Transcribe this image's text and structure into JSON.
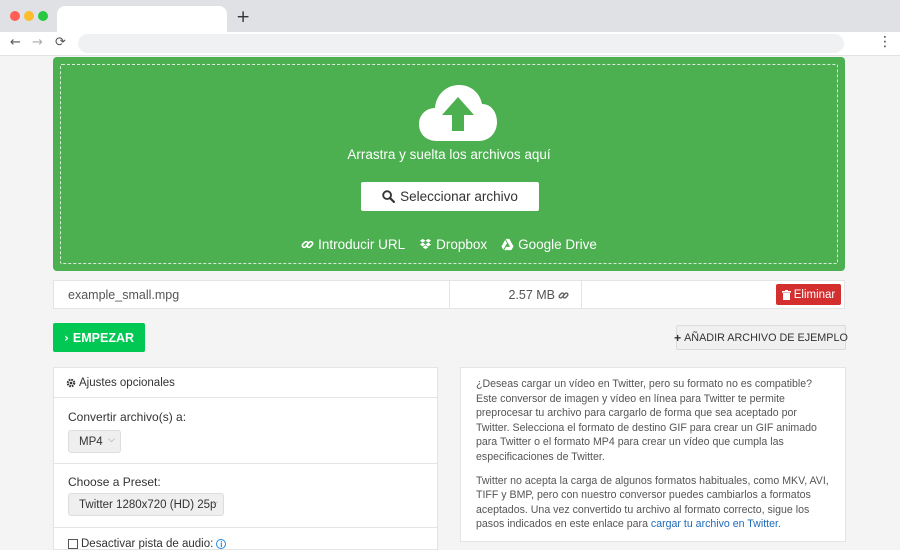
{
  "browser": {
    "new_tab": "+",
    "back": "←",
    "forward": "→",
    "reload": "⟳",
    "menu": "⋮"
  },
  "upload": {
    "drop_text": "Arrastra y suelta los archivos aquí",
    "select_button": "Seleccionar archivo",
    "sources": [
      "Introducir URL",
      "Dropbox",
      "Google Drive"
    ],
    "accent_color": "#4caf50"
  },
  "file": {
    "name": "example_small.mpg",
    "size": "2.57 MB",
    "delete_label": "Eliminar"
  },
  "actions": {
    "start_label": "EMPEZAR",
    "sample_label": "AÑADIR ARCHIVO DE EJEMPLO"
  },
  "options": {
    "header": "Ajustes opcionales",
    "convert_label": "Convertir archivo(s) a:",
    "convert_value": "MP4",
    "preset_label": "Choose a Preset:",
    "preset_value": "Twitter 1280x720 (HD) 25p",
    "disable_audio_label": "Desactivar pista de audio:"
  },
  "description": {
    "p1": "¿Deseas cargar un vídeo en Twitter, pero su formato no es compatible? Este conversor de imagen y vídeo en línea para Twitter te permite preprocesar tu archivo para cargarlo de forma que sea aceptado por Twitter. Selecciona el formato de destino GIF para crear un GIF animado para Twitter o el formato MP4 para crear un vídeo que cumpla las especificaciones de Twitter.",
    "p2_text": "Twitter no acepta la carga de algunos formatos habituales, como MKV, AVI, TIFF y BMP, pero con nuestro conversor puedes cambiarlos a formatos aceptados. Una vez convertido tu archivo al formato correcto, sigue los pasos indicados en este enlace para ",
    "p2_link": "cargar tu archivo en Twitter",
    "p2_end": "."
  }
}
